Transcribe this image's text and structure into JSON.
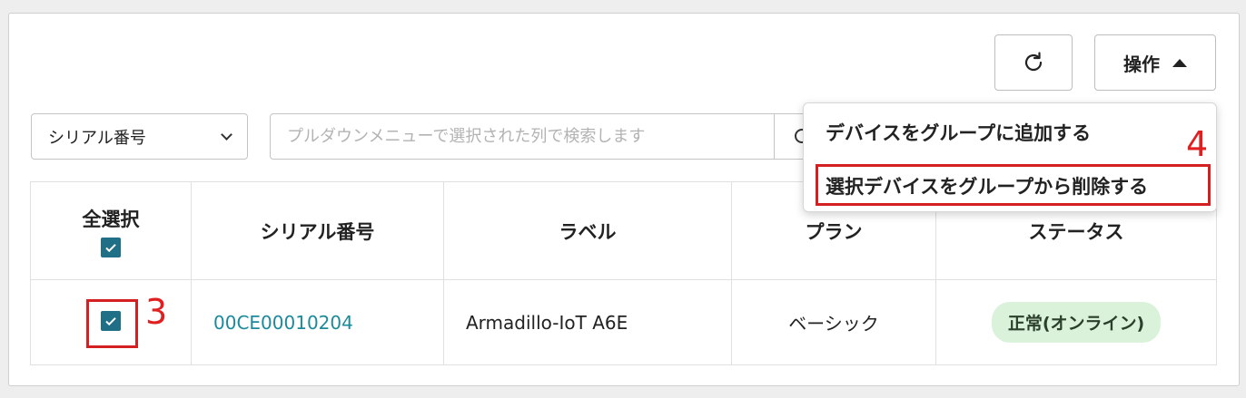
{
  "toolbar": {
    "refresh_icon": "refresh-icon",
    "operations_label": "操作",
    "operations_caret": "caret-up-icon"
  },
  "filter": {
    "column_select_value": "シリアル番号",
    "search_placeholder": "プルダウンメニューで選択された列で検索します"
  },
  "table": {
    "select_all_label": "全選択",
    "select_all_checked": true,
    "columns": [
      "シリアル番号",
      "ラベル",
      "プラン",
      "ステータス"
    ],
    "rows": [
      {
        "checked": true,
        "serial": "00CE00010204",
        "label": "Armadillo-IoT A6E",
        "plan": "ベーシック",
        "status": "正常(オンライン)"
      }
    ]
  },
  "dropdown_menu": {
    "items": [
      "デバイスをグループに追加する",
      "選択デバイスをグループから削除する"
    ]
  },
  "annotations": {
    "step_row_checkbox": "3",
    "step_menu_item": "4",
    "highlight_color": "#d42020"
  },
  "colors": {
    "accent": "#1f6f86",
    "link": "#1b8a9a",
    "status_badge_bg": "#d9f2d9"
  }
}
